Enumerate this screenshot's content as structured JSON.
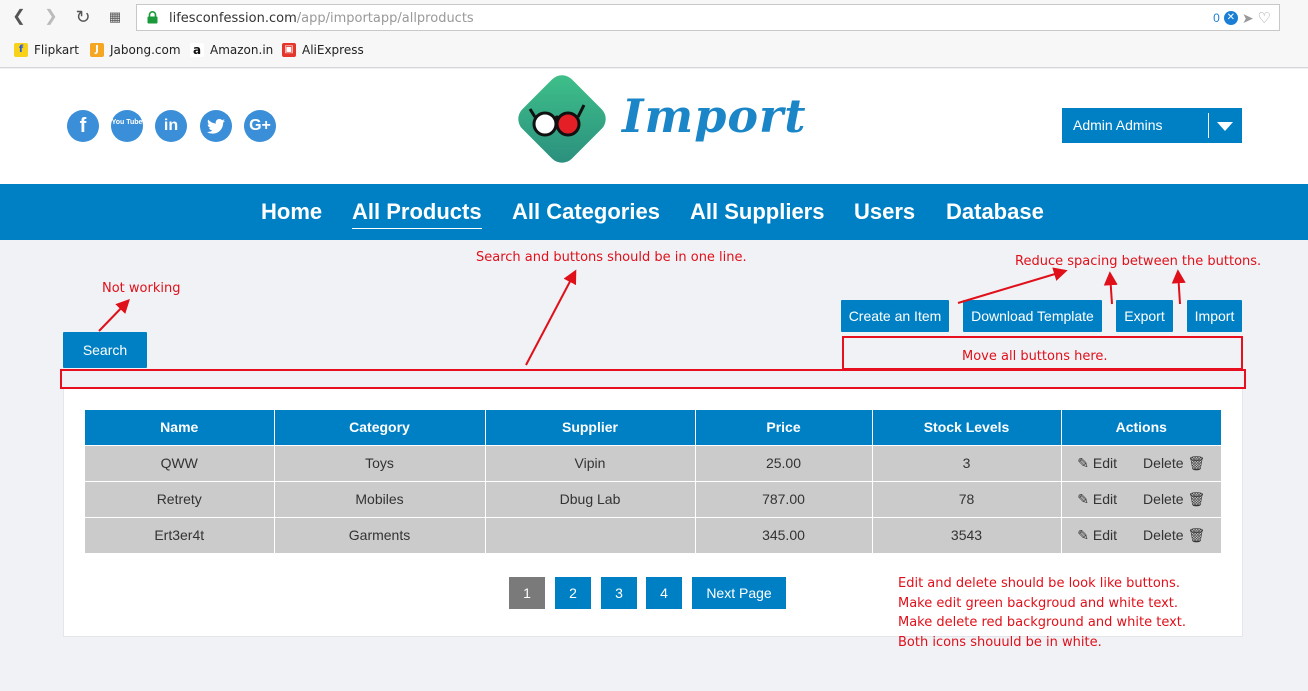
{
  "browser": {
    "url_host": "lifesconfession.com",
    "url_path": "/app/importapp/allproducts",
    "badge_count": "0",
    "bookmarks": [
      {
        "label": "Flipkart",
        "icon": "flipkart-icon"
      },
      {
        "label": "Jabong.com",
        "icon": "jabong-icon"
      },
      {
        "label": "Amazon.in",
        "icon": "amazon-icon"
      },
      {
        "label": "AliExpress",
        "icon": "aliexpress-icon"
      }
    ]
  },
  "header": {
    "social": [
      "f",
      "You Tube",
      "in",
      "twitter",
      "G+"
    ],
    "logo_text": "Import",
    "admin_label": "Admin Admins"
  },
  "nav": {
    "items": [
      "Home",
      "All Products",
      "All Categories",
      "All Suppliers",
      "Users",
      "Database"
    ],
    "active": "All Products"
  },
  "toolbar": {
    "search_label": "Search",
    "create_label": "Create an Item",
    "download_label": "Download Template",
    "export_label": "Export",
    "import_label": "Import"
  },
  "annotations": {
    "not_working": "Not working",
    "search_line": "Search and buttons should be in one line.",
    "reduce_spacing": "Reduce spacing between the buttons.",
    "move_buttons": "Move all buttons here.",
    "notes": [
      "Edit and delete should be look like buttons.",
      "Make edit green backgroud and white text.",
      "Make delete red background and white text.",
      "Both icons shouuld be in white."
    ]
  },
  "table": {
    "headers": [
      "Name",
      "Category",
      "Supplier",
      "Price",
      "Stock Levels",
      "Actions"
    ],
    "rows": [
      {
        "name": "QWW",
        "category": "Toys",
        "supplier": "Vipin",
        "price": "25.00",
        "stock": "3"
      },
      {
        "name": "Retrety",
        "category": "Mobiles",
        "supplier": "Dbug Lab",
        "price": "787.00",
        "stock": "78"
      },
      {
        "name": "Ert3er4t",
        "category": "Garments",
        "supplier": "",
        "price": "345.00",
        "stock": "3543"
      }
    ],
    "edit_label": "Edit",
    "delete_label": "Delete"
  },
  "pagination": {
    "pages": [
      "1",
      "2",
      "3",
      "4"
    ],
    "current": "1",
    "next_label": "Next Page"
  }
}
